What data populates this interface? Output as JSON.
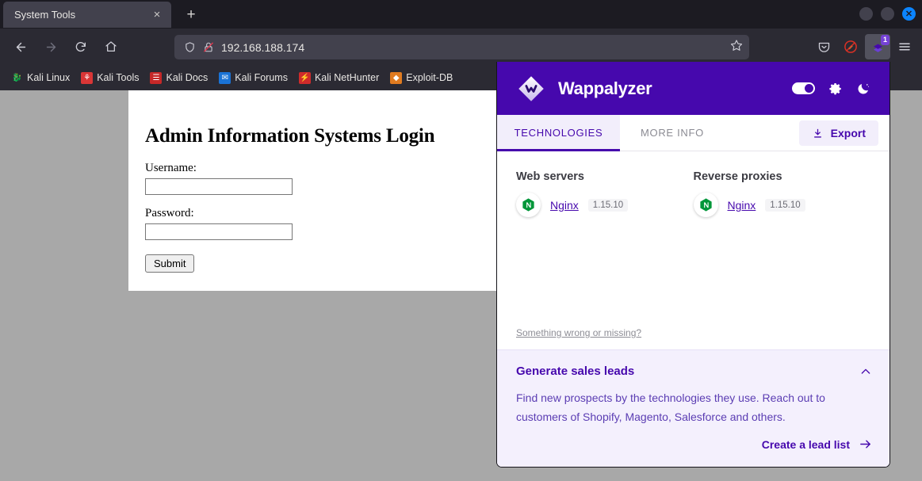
{
  "browser": {
    "tab": {
      "title": "System Tools",
      "close_label": "×"
    },
    "newtab_label": "+",
    "window_controls": {
      "minimize": "",
      "maximize": "",
      "close": "✕"
    },
    "nav": {
      "back": "←",
      "forward": "→",
      "reload": "⟳",
      "home": "⌂"
    },
    "url": "192.168.188.174",
    "url_shield_icon": "shield-icon",
    "url_lock_icon": "lock-crossed-icon",
    "bookmark_star_icon": "star-icon",
    "toolbar_right": {
      "pocket": "pocket-icon",
      "adblock": "adblock-icon",
      "extension": "wappalyzer-extension-icon",
      "extension_badge": "1",
      "menu": "hamburger-menu-icon"
    },
    "bookmarks": [
      {
        "label": "Kali Linux",
        "glyph": "🐉",
        "color": "#c9c9c9",
        "bg": "transparent"
      },
      {
        "label": "Kali Tools",
        "glyph": "⚘",
        "color": "#ffffff",
        "bg": "#d93636"
      },
      {
        "label": "Kali Docs",
        "glyph": "☰",
        "color": "#ffffff",
        "bg": "#c62828"
      },
      {
        "label": "Kali Forums",
        "glyph": "✉",
        "color": "#ffffff",
        "bg": "#1a73d6"
      },
      {
        "label": "Kali NetHunter",
        "glyph": "⚡",
        "color": "#ffffff",
        "bg": "#cf2b2b"
      },
      {
        "label": "Exploit-DB",
        "glyph": "◆",
        "color": "#ffffff",
        "bg": "#e07b20"
      }
    ]
  },
  "page": {
    "title": "Admin Information Systems Login",
    "username_label": "Username:",
    "username_value": "",
    "password_label": "Password:",
    "password_value": "",
    "submit_label": "Submit"
  },
  "wappalyzer": {
    "brand": "Wappalyzer",
    "header_icons": {
      "toggle": "toggle-switch",
      "settings": "gear-icon",
      "theme": "moon-icon"
    },
    "tabs": [
      {
        "label": "TECHNOLOGIES",
        "active": true
      },
      {
        "label": "MORE INFO",
        "active": false
      }
    ],
    "export_label": "Export",
    "export_icon": "download-icon",
    "categories": [
      {
        "name": "Web servers",
        "technologies": [
          {
            "name": "Nginx",
            "version": "1.15.10",
            "icon": "nginx-icon"
          }
        ]
      },
      {
        "name": "Reverse proxies",
        "technologies": [
          {
            "name": "Nginx",
            "version": "1.15.10",
            "icon": "nginx-icon"
          }
        ]
      }
    ],
    "feedback_link": "Something wrong or missing?",
    "promo": {
      "title": "Generate sales leads",
      "collapse_icon": "chevron-up-icon",
      "body": "Find new prospects by the technologies they use. Reach out to customers of Shopify, Magento, Salesforce and others.",
      "cta": "Create a lead list",
      "cta_icon": "arrow-right-icon"
    }
  },
  "colors": {
    "brand_purple": "#4608ad",
    "panel_tint": "#f4f0fd",
    "nginx_green": "#009639",
    "page_gray": "#a8a8a8"
  }
}
